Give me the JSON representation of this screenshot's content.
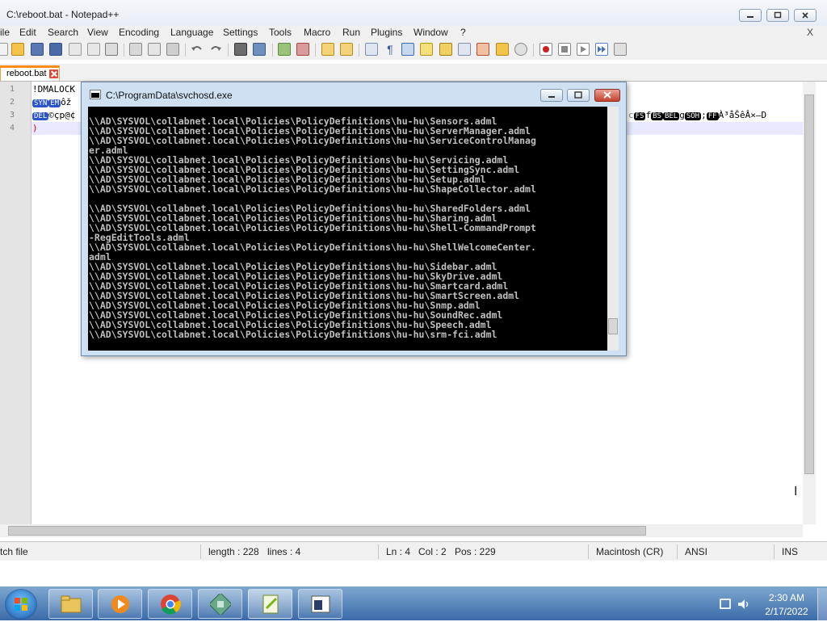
{
  "notepad": {
    "title": "C:\\reboot.bat - Notepad++",
    "menu": [
      "ile",
      "Edit",
      "Search",
      "View",
      "Encoding",
      "Language",
      "Settings",
      "Tools",
      "Macro",
      "Run",
      "Plugins",
      "Window",
      "?"
    ],
    "doc_close": "X",
    "tab": {
      "label": "reboot.bat"
    },
    "lines": [
      {
        "num": "1",
        "text": "!DMALOCK"
      },
      {
        "num": "2",
        "text_ctl1": "SYN",
        "text_ctl2": "EM",
        "text_rest": "ôž"
      },
      {
        "num": "3",
        "text_ctl1": "DEL",
        "text_rest": "©çp@¢",
        "text_tail_ctl1": "FS",
        "text_tail_mid1": "f",
        "text_tail_ctl2": "BS",
        "text_tail_ctl3": "BEL",
        "text_tail_mid2": "g",
        "text_tail_ctl4": "SOH",
        "text_tail_mid3": ";",
        "text_tail_ctl5": "FF",
        "text_tail_rest": "À³åŠêÂ×–D"
      },
      {
        "num": "4",
        "text": ")"
      }
    ],
    "status": {
      "file_type": "tch file",
      "length": "length : 228",
      "lines": "lines : 4",
      "ln": "Ln : 4",
      "col": "Col : 2",
      "pos": "Pos : 229",
      "eol": "Macintosh (CR)",
      "encoding": "ANSI",
      "mode": "INS"
    }
  },
  "console": {
    "title": "C:\\ProgramData\\svchosd.exe",
    "output": "\\\\AD\\SYSVOL\\collabnet.local\\Policies\\PolicyDefinitions\\hu-hu\\Sensors.adml\n\\\\AD\\SYSVOL\\collabnet.local\\Policies\\PolicyDefinitions\\hu-hu\\ServerManager.adml\n\\\\AD\\SYSVOL\\collabnet.local\\Policies\\PolicyDefinitions\\hu-hu\\ServiceControlManag\ner.adml\n\\\\AD\\SYSVOL\\collabnet.local\\Policies\\PolicyDefinitions\\hu-hu\\Servicing.adml\n\\\\AD\\SYSVOL\\collabnet.local\\Policies\\PolicyDefinitions\\hu-hu\\SettingSync.adml\n\\\\AD\\SYSVOL\\collabnet.local\\Policies\\PolicyDefinitions\\hu-hu\\Setup.adml\n\\\\AD\\SYSVOL\\collabnet.local\\Policies\\PolicyDefinitions\\hu-hu\\ShapeCollector.adml\n\n\\\\AD\\SYSVOL\\collabnet.local\\Policies\\PolicyDefinitions\\hu-hu\\SharedFolders.adml\n\\\\AD\\SYSVOL\\collabnet.local\\Policies\\PolicyDefinitions\\hu-hu\\Sharing.adml\n\\\\AD\\SYSVOL\\collabnet.local\\Policies\\PolicyDefinitions\\hu-hu\\Shell-CommandPrompt\n-RegEditTools.adml\n\\\\AD\\SYSVOL\\collabnet.local\\Policies\\PolicyDefinitions\\hu-hu\\ShellWelcomeCenter.\nadml\n\\\\AD\\SYSVOL\\collabnet.local\\Policies\\PolicyDefinitions\\hu-hu\\Sidebar.adml\n\\\\AD\\SYSVOL\\collabnet.local\\Policies\\PolicyDefinitions\\hu-hu\\SkyDrive.adml\n\\\\AD\\SYSVOL\\collabnet.local\\Policies\\PolicyDefinitions\\hu-hu\\Smartcard.adml\n\\\\AD\\SYSVOL\\collabnet.local\\Policies\\PolicyDefinitions\\hu-hu\\SmartScreen.adml\n\\\\AD\\SYSVOL\\collabnet.local\\Policies\\PolicyDefinitions\\hu-hu\\Snmp.adml\n\\\\AD\\SYSVOL\\collabnet.local\\Policies\\PolicyDefinitions\\hu-hu\\SoundRec.adml\n\\\\AD\\SYSVOL\\collabnet.local\\Policies\\PolicyDefinitions\\hu-hu\\Speech.adml\n\\\\AD\\SYSVOL\\collabnet.local\\Policies\\PolicyDefinitions\\hu-hu\\srm-fci.adml"
  },
  "taskbar": {
    "apps": [
      "explorer-icon",
      "media-player-icon",
      "chrome-icon",
      "network-app-icon",
      "notepadpp-icon",
      "console-app-icon"
    ],
    "time": "2:30 AM",
    "date": "2/17/2022"
  }
}
